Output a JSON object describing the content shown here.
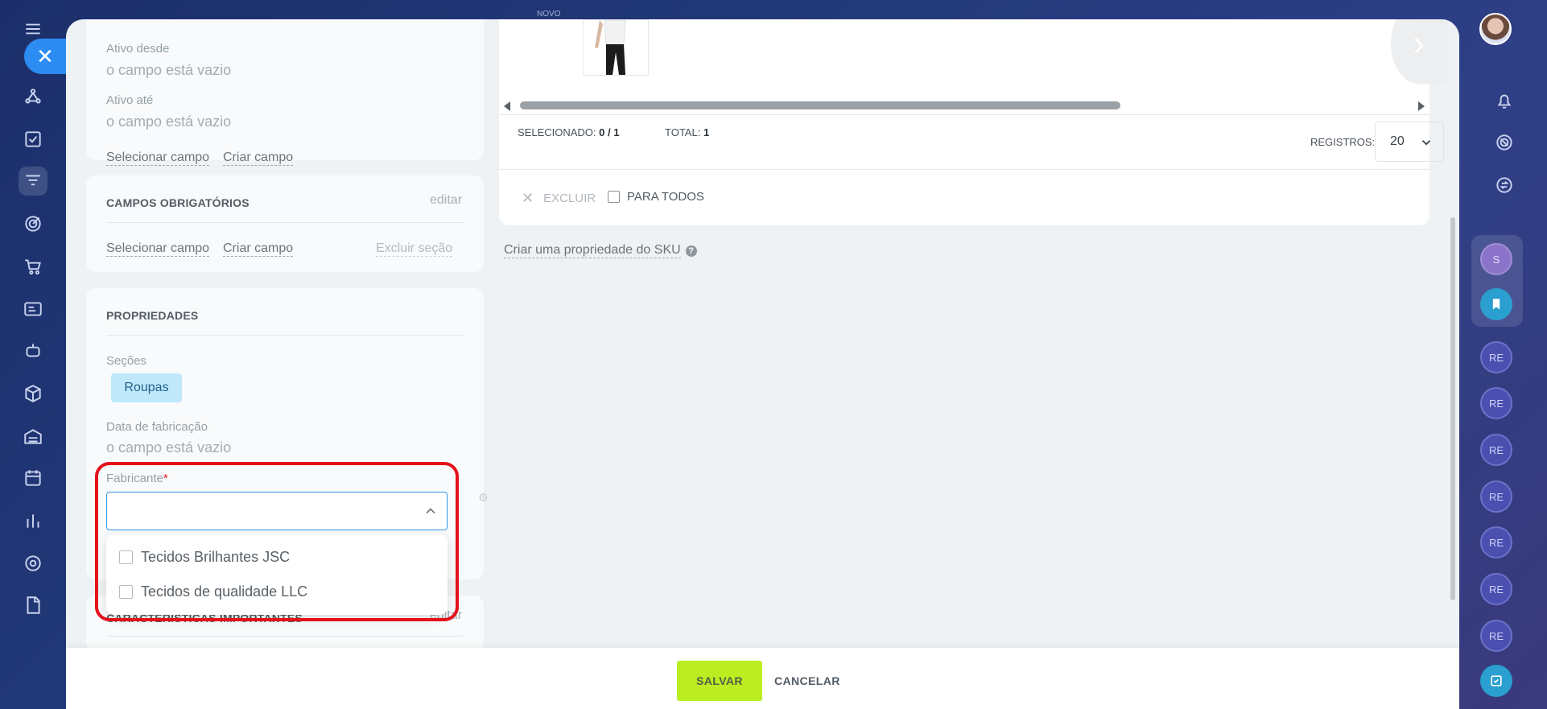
{
  "topbar": {
    "new_label": "NOVO"
  },
  "left_panel": {
    "active_from_label": "Ativo desde",
    "active_from_value": "o campo está vazio",
    "active_to_label": "Ativo até",
    "active_to_value": "o campo está vazio",
    "select_field_link": "Selecionar campo",
    "create_field_link": "Criar campo",
    "required_section": {
      "title": "CAMPOS OBRIGATÓRIOS",
      "edit_label": "editar",
      "select_field_link": "Selecionar campo",
      "create_field_link": "Criar campo",
      "delete_section_link": "Excluir seção"
    },
    "properties_section": {
      "title": "PROPRIEDADES",
      "sections_label": "Seções",
      "section_tag": "Roupas",
      "manufacture_date_label": "Data de fabricação",
      "manufacture_date_value": "o campo está vazio",
      "manufacturer_label": "Fabricante",
      "required_mark": "*",
      "manufacturer_options": [
        "Tecidos Brilhantes JSC",
        "Tecidos de qualidade LLC"
      ]
    },
    "important_section": {
      "title": "CARACTERÍSTICAS IMPORTANTES",
      "edit_label": "editar"
    }
  },
  "right_panel": {
    "selected_label": "SELECIONADO:",
    "selected_value": "0 / 1",
    "total_label": "TOTAL:",
    "total_value": "1",
    "records_label": "REGISTROS:",
    "records_value": "20",
    "delete_label": "EXCLUIR",
    "for_all_label": "PARA TODOS",
    "create_sku_property_link": "Criar uma propriedade do SKU"
  },
  "footer": {
    "save_label": "SALVAR",
    "cancel_label": "CANCELAR"
  },
  "right_sidebar": {
    "s_avatar_letter": "S",
    "re_avatar_labels": [
      "RE",
      "RE",
      "RE",
      "RE",
      "RE",
      "RE",
      "RE"
    ]
  },
  "colors": {
    "accent": "#2f96e8",
    "save": "#bbed21",
    "highlight": "#e4111a",
    "tag_bg": "#bfe9fb"
  }
}
